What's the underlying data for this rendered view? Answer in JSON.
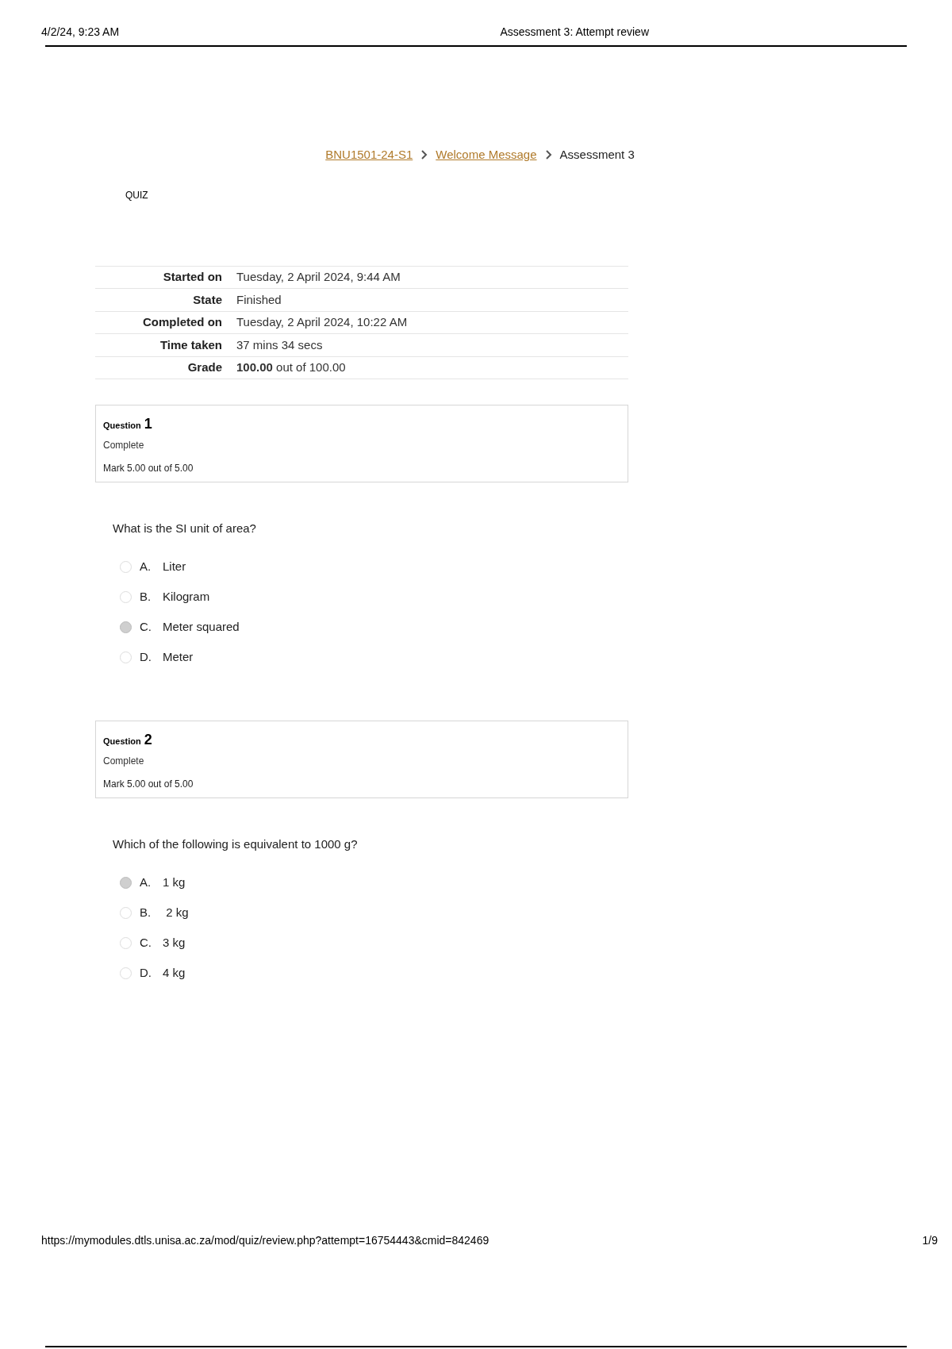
{
  "print_header": {
    "date": "4/2/24, 9:23 AM",
    "title": "Assessment 3: Attempt review"
  },
  "breadcrumb": [
    {
      "label": "BNU1501-24-S1",
      "kind": "link"
    },
    {
      "label": "Welcome Message",
      "kind": "link"
    },
    {
      "label": "Assessment 3",
      "kind": "current"
    }
  ],
  "section_label": "QUIZ",
  "summary": [
    {
      "label": "Started on",
      "value": "Tuesday, 2 April 2024, 9:44 AM"
    },
    {
      "label": "State",
      "value": "Finished"
    },
    {
      "label": "Completed on",
      "value": "Tuesday, 2 April 2024, 10:22 AM"
    },
    {
      "label": "Time taken",
      "value": "37 mins 34 secs"
    },
    {
      "label": "Grade",
      "value": "**100.00** out of 100.00"
    }
  ],
  "questions": [
    {
      "heading": "Question",
      "number": "1",
      "status": "Complete",
      "mark": "Mark 5.00 out of 5.00",
      "text": "What is the SI unit of area?",
      "options": [
        {
          "letter": "A.",
          "label": "Liter",
          "selected": false
        },
        {
          "letter": "B.",
          "label": "Kilogram",
          "selected": false
        },
        {
          "letter": "C.",
          "label": "Meter squared",
          "selected": true
        },
        {
          "letter": "D.",
          "label": "Meter",
          "selected": false
        }
      ]
    },
    {
      "heading": "Question",
      "number": "2",
      "status": "Complete",
      "mark": "Mark 5.00 out of 5.00",
      "text": "Which of the following is equivalent to 1000 g?",
      "options": [
        {
          "letter": "A.",
          "label": "1 kg",
          "selected": true
        },
        {
          "letter": "B.",
          "label": " 2 kg",
          "selected": false
        },
        {
          "letter": "C.",
          "label": "3 kg",
          "selected": false
        },
        {
          "letter": "D.",
          "label": "4 kg",
          "selected": false
        }
      ]
    }
  ],
  "print_footer": {
    "url": "https://mymodules.dtls.unisa.ac.za/mod/quiz/review.php?attempt=16754443&cmid=842469",
    "page": "1/9"
  }
}
